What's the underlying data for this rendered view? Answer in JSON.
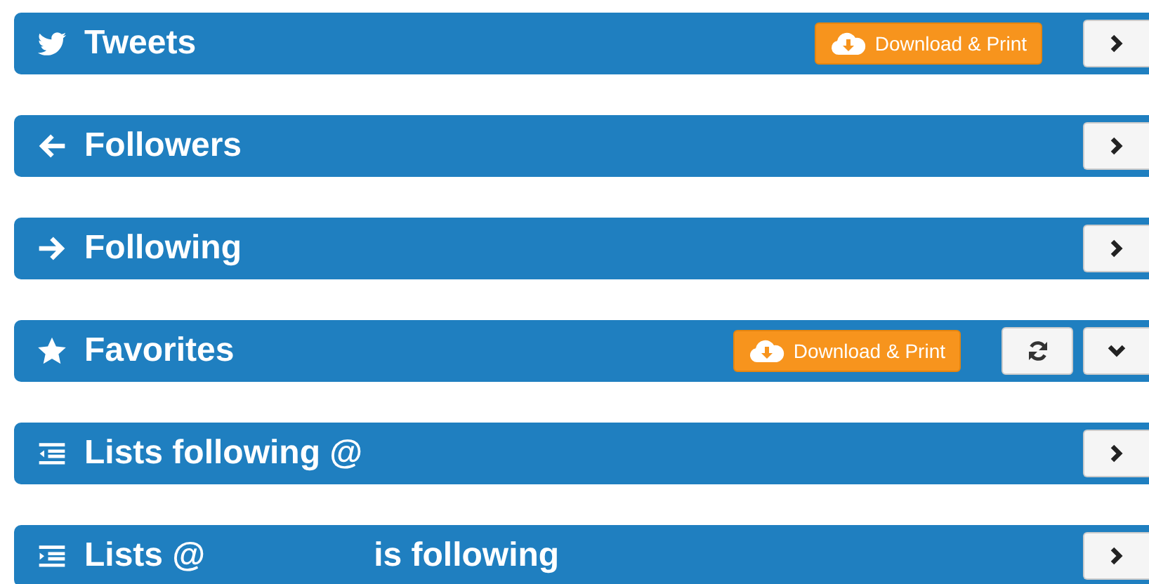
{
  "panels": [
    {
      "title": "Tweets",
      "expanded": false,
      "actions": [
        {
          "kind": "download",
          "label": "Download & Print"
        }
      ]
    },
    {
      "title": "Followers",
      "expanded": false
    },
    {
      "title": "Following",
      "expanded": false
    },
    {
      "title": "Favorites",
      "expanded": true,
      "actions": [
        {
          "kind": "download",
          "label": "Download & Print"
        },
        {
          "kind": "refresh"
        }
      ]
    },
    {
      "title": "Lists following @",
      "expanded": false
    },
    {
      "title": "Lists @",
      "title_suffix": "is following",
      "expanded": false
    }
  ]
}
